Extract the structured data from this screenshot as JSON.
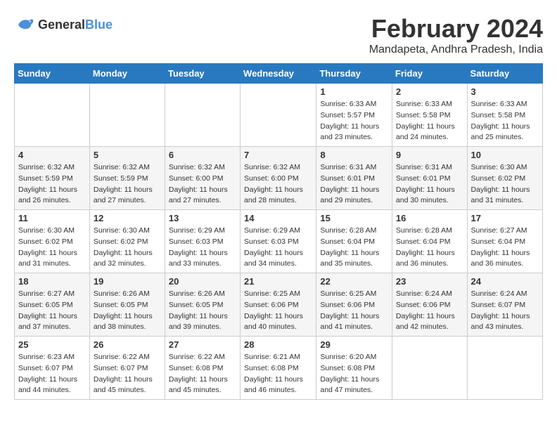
{
  "header": {
    "logo_line1": "General",
    "logo_line2": "Blue",
    "month": "February 2024",
    "location": "Mandapeta, Andhra Pradesh, India"
  },
  "weekdays": [
    "Sunday",
    "Monday",
    "Tuesday",
    "Wednesday",
    "Thursday",
    "Friday",
    "Saturday"
  ],
  "weeks": [
    [
      {
        "day": "",
        "sunrise": "",
        "sunset": "",
        "daylight": ""
      },
      {
        "day": "",
        "sunrise": "",
        "sunset": "",
        "daylight": ""
      },
      {
        "day": "",
        "sunrise": "",
        "sunset": "",
        "daylight": ""
      },
      {
        "day": "",
        "sunrise": "",
        "sunset": "",
        "daylight": ""
      },
      {
        "day": "1",
        "sunrise": "6:33 AM",
        "sunset": "5:57 PM",
        "daylight": "11 hours and 23 minutes."
      },
      {
        "day": "2",
        "sunrise": "6:33 AM",
        "sunset": "5:58 PM",
        "daylight": "11 hours and 24 minutes."
      },
      {
        "day": "3",
        "sunrise": "6:33 AM",
        "sunset": "5:58 PM",
        "daylight": "11 hours and 25 minutes."
      }
    ],
    [
      {
        "day": "4",
        "sunrise": "6:32 AM",
        "sunset": "5:59 PM",
        "daylight": "11 hours and 26 minutes."
      },
      {
        "day": "5",
        "sunrise": "6:32 AM",
        "sunset": "5:59 PM",
        "daylight": "11 hours and 27 minutes."
      },
      {
        "day": "6",
        "sunrise": "6:32 AM",
        "sunset": "6:00 PM",
        "daylight": "11 hours and 27 minutes."
      },
      {
        "day": "7",
        "sunrise": "6:32 AM",
        "sunset": "6:00 PM",
        "daylight": "11 hours and 28 minutes."
      },
      {
        "day": "8",
        "sunrise": "6:31 AM",
        "sunset": "6:01 PM",
        "daylight": "11 hours and 29 minutes."
      },
      {
        "day": "9",
        "sunrise": "6:31 AM",
        "sunset": "6:01 PM",
        "daylight": "11 hours and 30 minutes."
      },
      {
        "day": "10",
        "sunrise": "6:30 AM",
        "sunset": "6:02 PM",
        "daylight": "11 hours and 31 minutes."
      }
    ],
    [
      {
        "day": "11",
        "sunrise": "6:30 AM",
        "sunset": "6:02 PM",
        "daylight": "11 hours and 31 minutes."
      },
      {
        "day": "12",
        "sunrise": "6:30 AM",
        "sunset": "6:02 PM",
        "daylight": "11 hours and 32 minutes."
      },
      {
        "day": "13",
        "sunrise": "6:29 AM",
        "sunset": "6:03 PM",
        "daylight": "11 hours and 33 minutes."
      },
      {
        "day": "14",
        "sunrise": "6:29 AM",
        "sunset": "6:03 PM",
        "daylight": "11 hours and 34 minutes."
      },
      {
        "day": "15",
        "sunrise": "6:28 AM",
        "sunset": "6:04 PM",
        "daylight": "11 hours and 35 minutes."
      },
      {
        "day": "16",
        "sunrise": "6:28 AM",
        "sunset": "6:04 PM",
        "daylight": "11 hours and 36 minutes."
      },
      {
        "day": "17",
        "sunrise": "6:27 AM",
        "sunset": "6:04 PM",
        "daylight": "11 hours and 36 minutes."
      }
    ],
    [
      {
        "day": "18",
        "sunrise": "6:27 AM",
        "sunset": "6:05 PM",
        "daylight": "11 hours and 37 minutes."
      },
      {
        "day": "19",
        "sunrise": "6:26 AM",
        "sunset": "6:05 PM",
        "daylight": "11 hours and 38 minutes."
      },
      {
        "day": "20",
        "sunrise": "6:26 AM",
        "sunset": "6:05 PM",
        "daylight": "11 hours and 39 minutes."
      },
      {
        "day": "21",
        "sunrise": "6:25 AM",
        "sunset": "6:06 PM",
        "daylight": "11 hours and 40 minutes."
      },
      {
        "day": "22",
        "sunrise": "6:25 AM",
        "sunset": "6:06 PM",
        "daylight": "11 hours and 41 minutes."
      },
      {
        "day": "23",
        "sunrise": "6:24 AM",
        "sunset": "6:06 PM",
        "daylight": "11 hours and 42 minutes."
      },
      {
        "day": "24",
        "sunrise": "6:24 AM",
        "sunset": "6:07 PM",
        "daylight": "11 hours and 43 minutes."
      }
    ],
    [
      {
        "day": "25",
        "sunrise": "6:23 AM",
        "sunset": "6:07 PM",
        "daylight": "11 hours and 44 minutes."
      },
      {
        "day": "26",
        "sunrise": "6:22 AM",
        "sunset": "6:07 PM",
        "daylight": "11 hours and 45 minutes."
      },
      {
        "day": "27",
        "sunrise": "6:22 AM",
        "sunset": "6:08 PM",
        "daylight": "11 hours and 45 minutes."
      },
      {
        "day": "28",
        "sunrise": "6:21 AM",
        "sunset": "6:08 PM",
        "daylight": "11 hours and 46 minutes."
      },
      {
        "day": "29",
        "sunrise": "6:20 AM",
        "sunset": "6:08 PM",
        "daylight": "11 hours and 47 minutes."
      },
      {
        "day": "",
        "sunrise": "",
        "sunset": "",
        "daylight": ""
      },
      {
        "day": "",
        "sunrise": "",
        "sunset": "",
        "daylight": ""
      }
    ]
  ]
}
